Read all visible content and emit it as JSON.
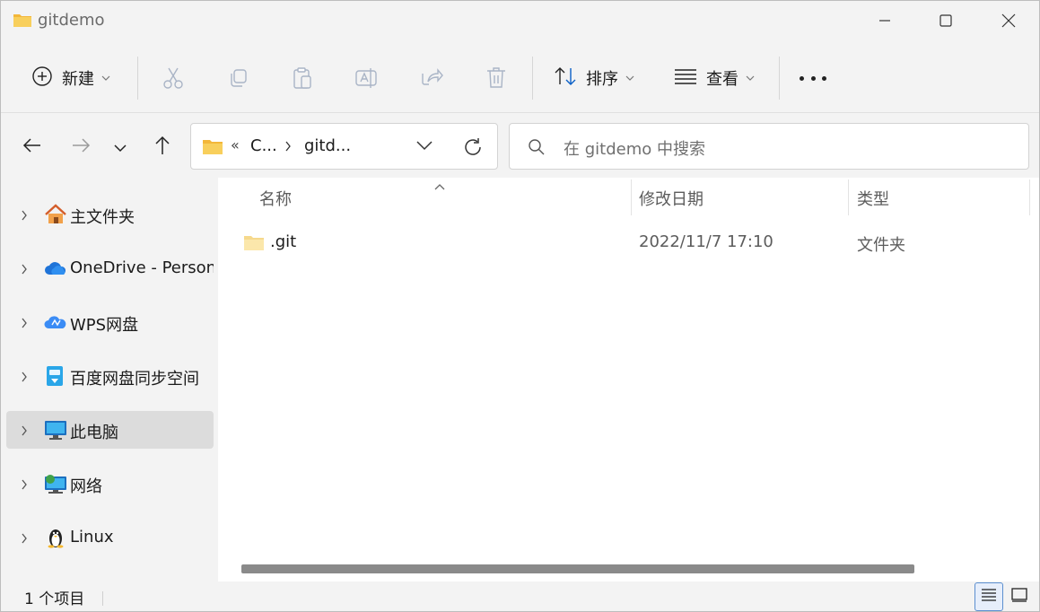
{
  "window": {
    "title": "gitdemo"
  },
  "toolbar": {
    "new_label": "新建",
    "sort_label": "排序",
    "view_label": "查看",
    "icons": [
      "cut-icon",
      "copy-icon",
      "paste-icon",
      "rename-icon",
      "share-icon",
      "delete-icon"
    ]
  },
  "address": {
    "overflow": "«",
    "crumbs": [
      "C...",
      "gitd..."
    ]
  },
  "search": {
    "placeholder": "在 gitdemo 中搜索"
  },
  "sidebar": {
    "items": [
      {
        "label": "主文件夹",
        "icon": "home-icon"
      },
      {
        "label": "OneDrive - Personal",
        "icon": "onedrive-cloud-icon"
      },
      {
        "label": "WPS网盘",
        "icon": "wps-cloud-icon"
      },
      {
        "label": "百度网盘同步空间",
        "icon": "baidu-netdisk-icon"
      },
      {
        "label": "此电脑",
        "icon": "computer-icon",
        "selected": true
      },
      {
        "label": "网络",
        "icon": "network-icon"
      },
      {
        "label": "Linux",
        "icon": "linux-penguin-icon"
      }
    ]
  },
  "table": {
    "columns": [
      "名称",
      "修改日期",
      "类型"
    ],
    "rows": [
      {
        "name": ".git",
        "modified": "2022/11/7 17:10",
        "type": "文件夹"
      }
    ]
  },
  "status": {
    "count_text": "1 个项目"
  },
  "colors": {
    "accent": "#0a5fc6",
    "folder": "#f8c84a",
    "selection": "#dcdcdc"
  }
}
